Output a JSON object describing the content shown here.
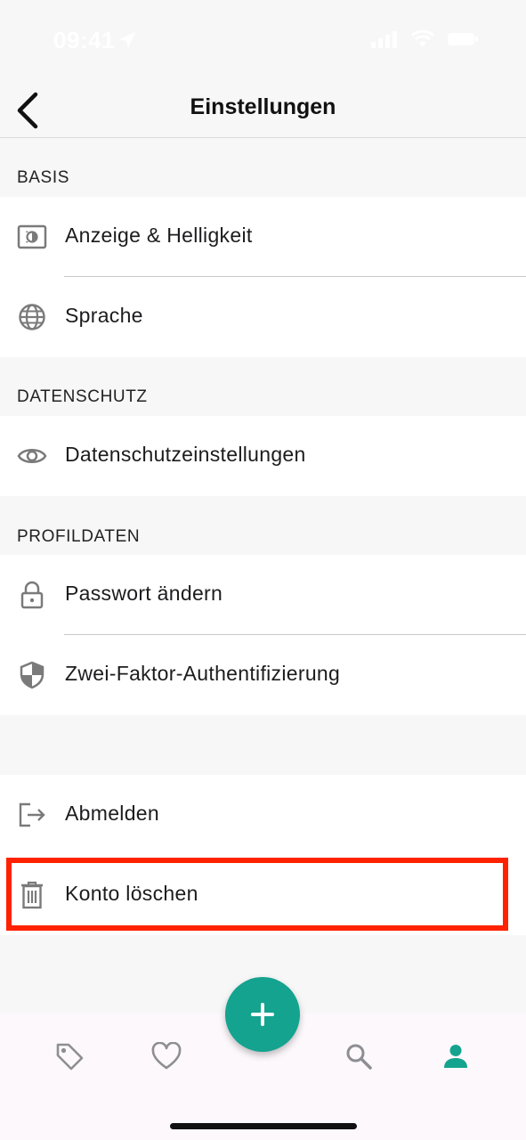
{
  "status_bar": {
    "time": "09:41"
  },
  "nav": {
    "title": "Einstellungen"
  },
  "sections": {
    "basis": {
      "header": "BASIS",
      "items": [
        {
          "label": "Anzeige & Helligkeit",
          "icon": "display-brightness-icon"
        },
        {
          "label": "Sprache",
          "icon": "globe-icon"
        }
      ]
    },
    "datenschutz": {
      "header": "DATENSCHUTZ",
      "items": [
        {
          "label": "Datenschutzeinstellungen",
          "icon": "eye-icon"
        }
      ]
    },
    "profildaten": {
      "header": "PROFILDATEN",
      "items": [
        {
          "label": "Passwort ändern",
          "icon": "lock-icon"
        },
        {
          "label": "Zwei-Faktor-Authentifizierung",
          "icon": "shield-icon"
        }
      ]
    },
    "account": {
      "items": [
        {
          "label": "Abmelden",
          "icon": "logout-icon"
        },
        {
          "label": "Konto löschen",
          "icon": "trash-icon"
        }
      ]
    }
  },
  "tabbar": {
    "items": [
      "tag-icon",
      "heart-icon",
      "plus-icon",
      "search-icon",
      "person-icon"
    ],
    "active": "person-icon",
    "colors": {
      "accent": "#14a38f",
      "inactive": "#8e8e93",
      "highlight": "#ff2200"
    }
  }
}
